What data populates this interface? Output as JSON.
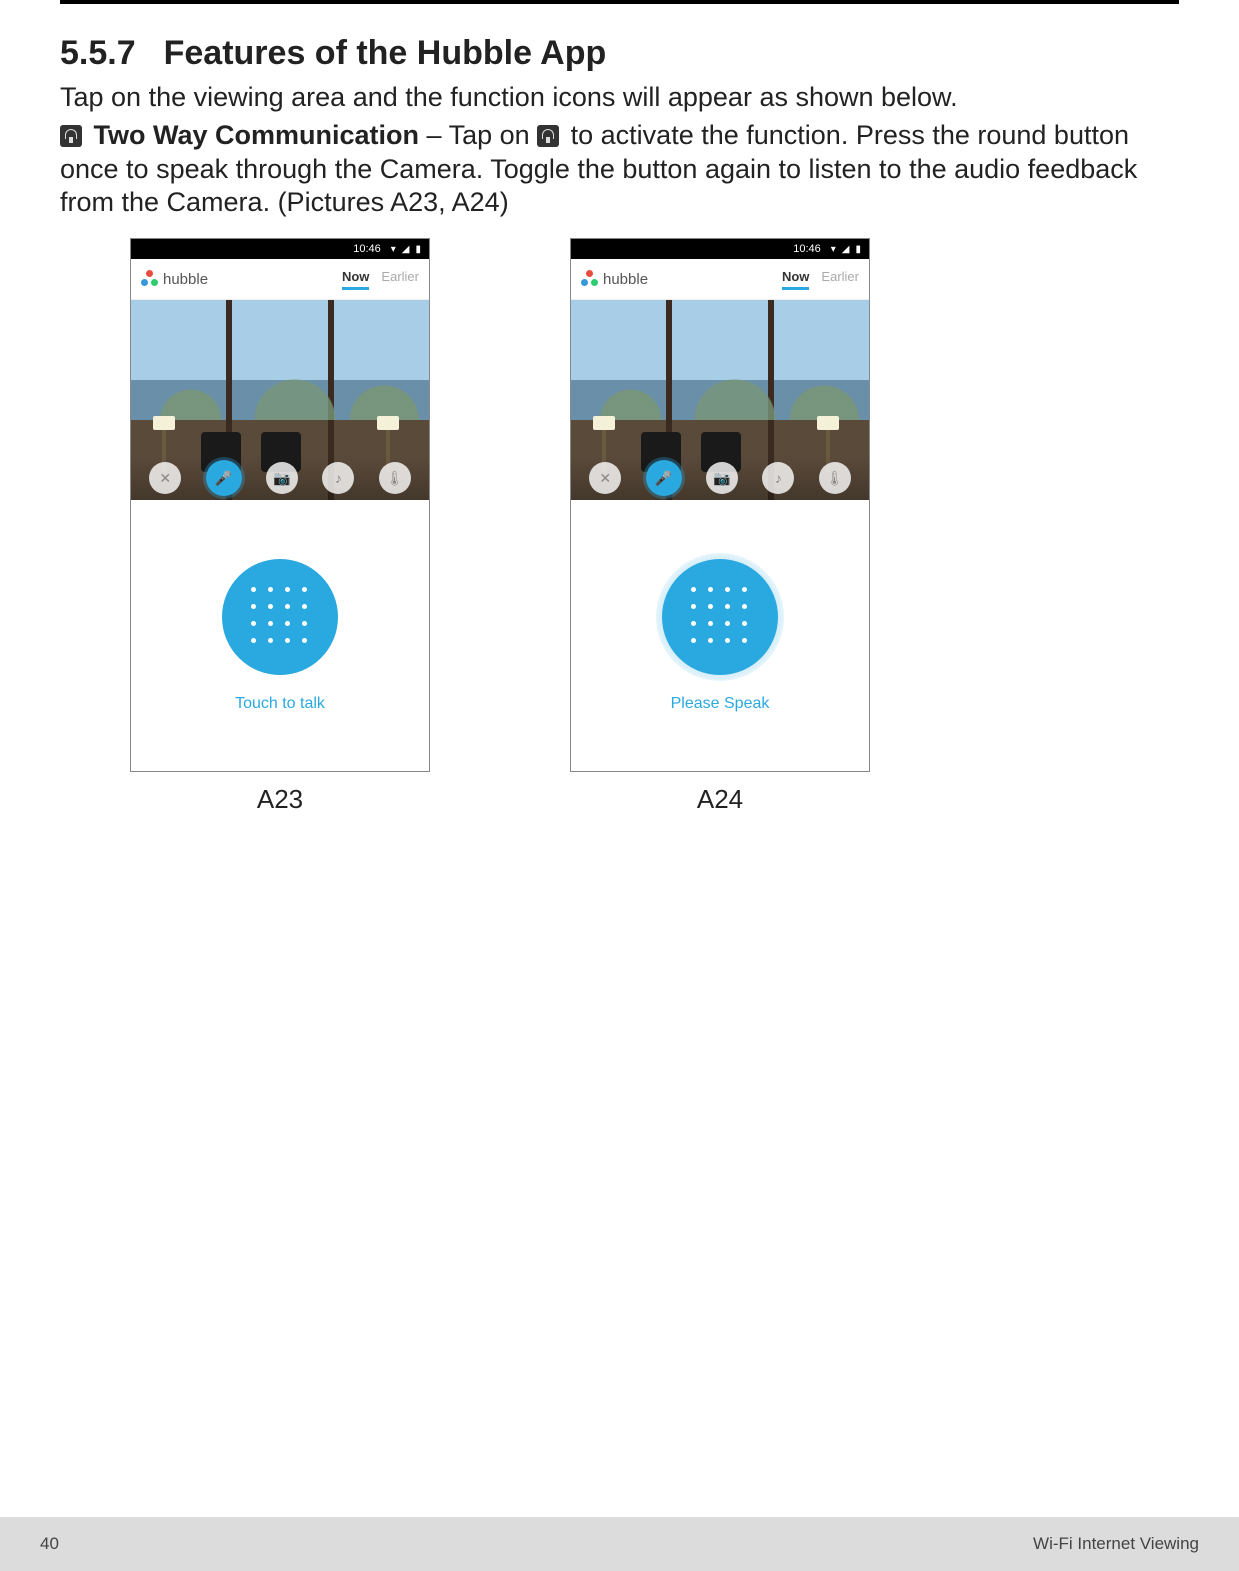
{
  "section": {
    "number": "5.5.7",
    "title": "Features of the Hubble App"
  },
  "paragraphs": {
    "intro": "Tap on the viewing area and the function icons will appear as shown below.",
    "feature_name": "Two Way Communication",
    "feature_sep": " – Tap on ",
    "feature_rest": " to activate the function. Press the round button once to speak through the Camera. Toggle the button again to listen to the audio feedback from the Camera. (Pictures A23, A24)"
  },
  "phone_shared": {
    "status_time": "10:46",
    "app_name": "hubble",
    "tabs": {
      "now": "Now",
      "earlier": "Earlier"
    }
  },
  "figures": {
    "a23": {
      "label": "A23",
      "talk_label": "Touch to talk",
      "state": "idle"
    },
    "a24": {
      "label": "A24",
      "talk_label": "Please Speak",
      "state": "speaking"
    }
  },
  "footer": {
    "page_number": "40",
    "chapter": "Wi-Fi Internet Viewing"
  }
}
